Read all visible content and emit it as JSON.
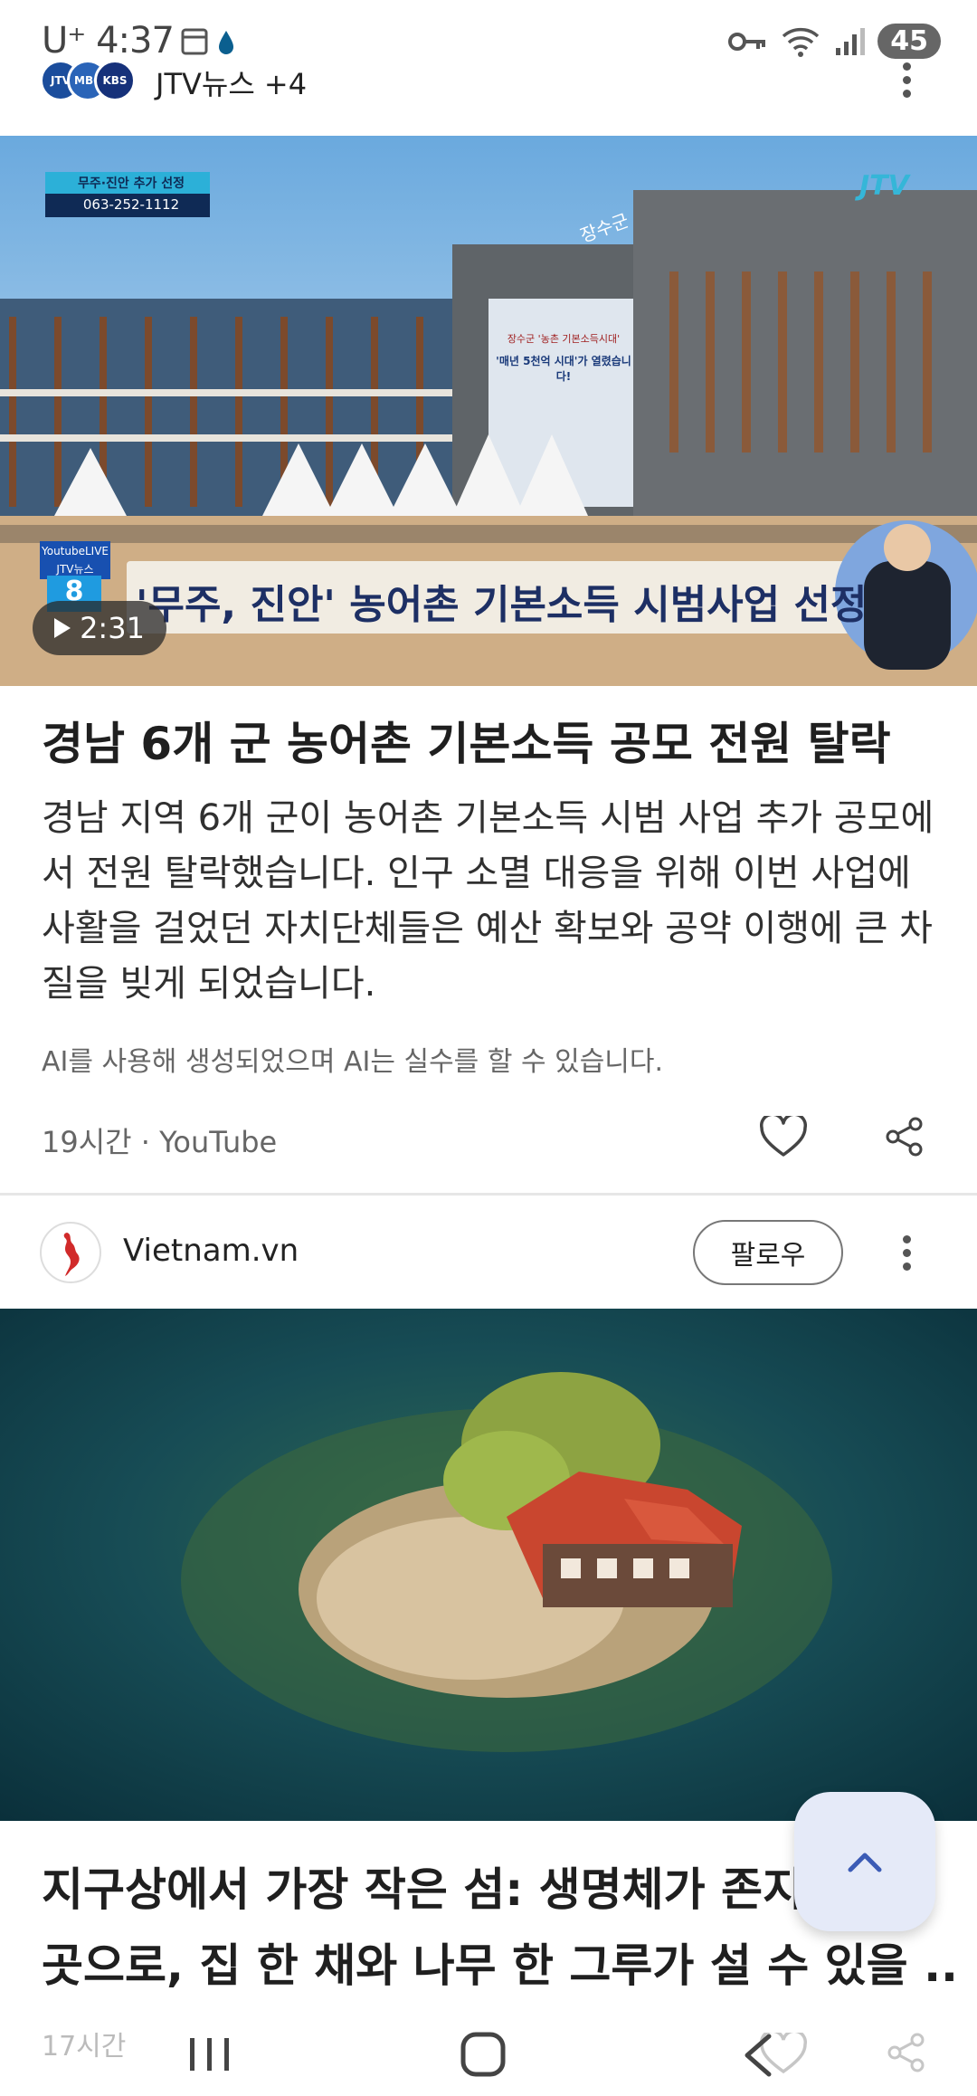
{
  "status_bar": {
    "carrier": "U⁺",
    "time": "4:37",
    "battery": "45"
  },
  "source_header": {
    "title": "JTV뉴스 +4",
    "logos": [
      "JTV NEWS",
      "MBC NEWS",
      "KBS NEWS"
    ]
  },
  "article1": {
    "video_overlay": {
      "tag_title": "무주·진안 추가 선정",
      "tag_phone": "063-252-1112",
      "channel_logo": "JTV",
      "ticker": "'무주, 진안' 농어촌 기본소득 시범사업 선정",
      "building_sign": "장수군",
      "banner_line1": "장수군 '농촌 기본소득시대'",
      "banner_line2": "'매년 5천억 시대'가 열렸습니다!",
      "live_badge": "YoutubeLIVE",
      "live_channel": "JTV뉴스",
      "live_number": "8"
    },
    "duration": "2:31",
    "headline": "경남 6개 군 농어촌 기본소득 공모 전원 탈락",
    "summary": "경남 지역 6개 군이 농어촌 기본소득 시범 사업 추가 공모에서 전원 탈락했습니다. 인구 소멸 대응을 위해 이번 사업에 사활을 걸었던 자치단체들은 예산 확보와 공약 이행에 큰 차질을 빚게 되었습니다.",
    "ai_note": "AI를 사용해 생성되었으며 AI는 실수를 할 수 있습니다.",
    "meta": "19시간 · YouTube"
  },
  "article2": {
    "source_name": "Vietnam.vn",
    "follow_label": "팔로우",
    "headline": "지구상에서 가장 작은 섬: 생명체가 존재하는 곳으로, 집 한 채와 나무 한 그루가 설 수 있을 …",
    "headline_line1": "지구상에서 가장 작은 섬: 생명체가 존지",
    "headline_line2": "곳으로, 집 한 채와 나무 한 그루가 설 수 있을 ...",
    "meta": "17시간"
  },
  "colors": {
    "accent_fab": "#e5eaf8",
    "fab_icon": "#3b5bb5",
    "divider": "#e6e6e6"
  }
}
